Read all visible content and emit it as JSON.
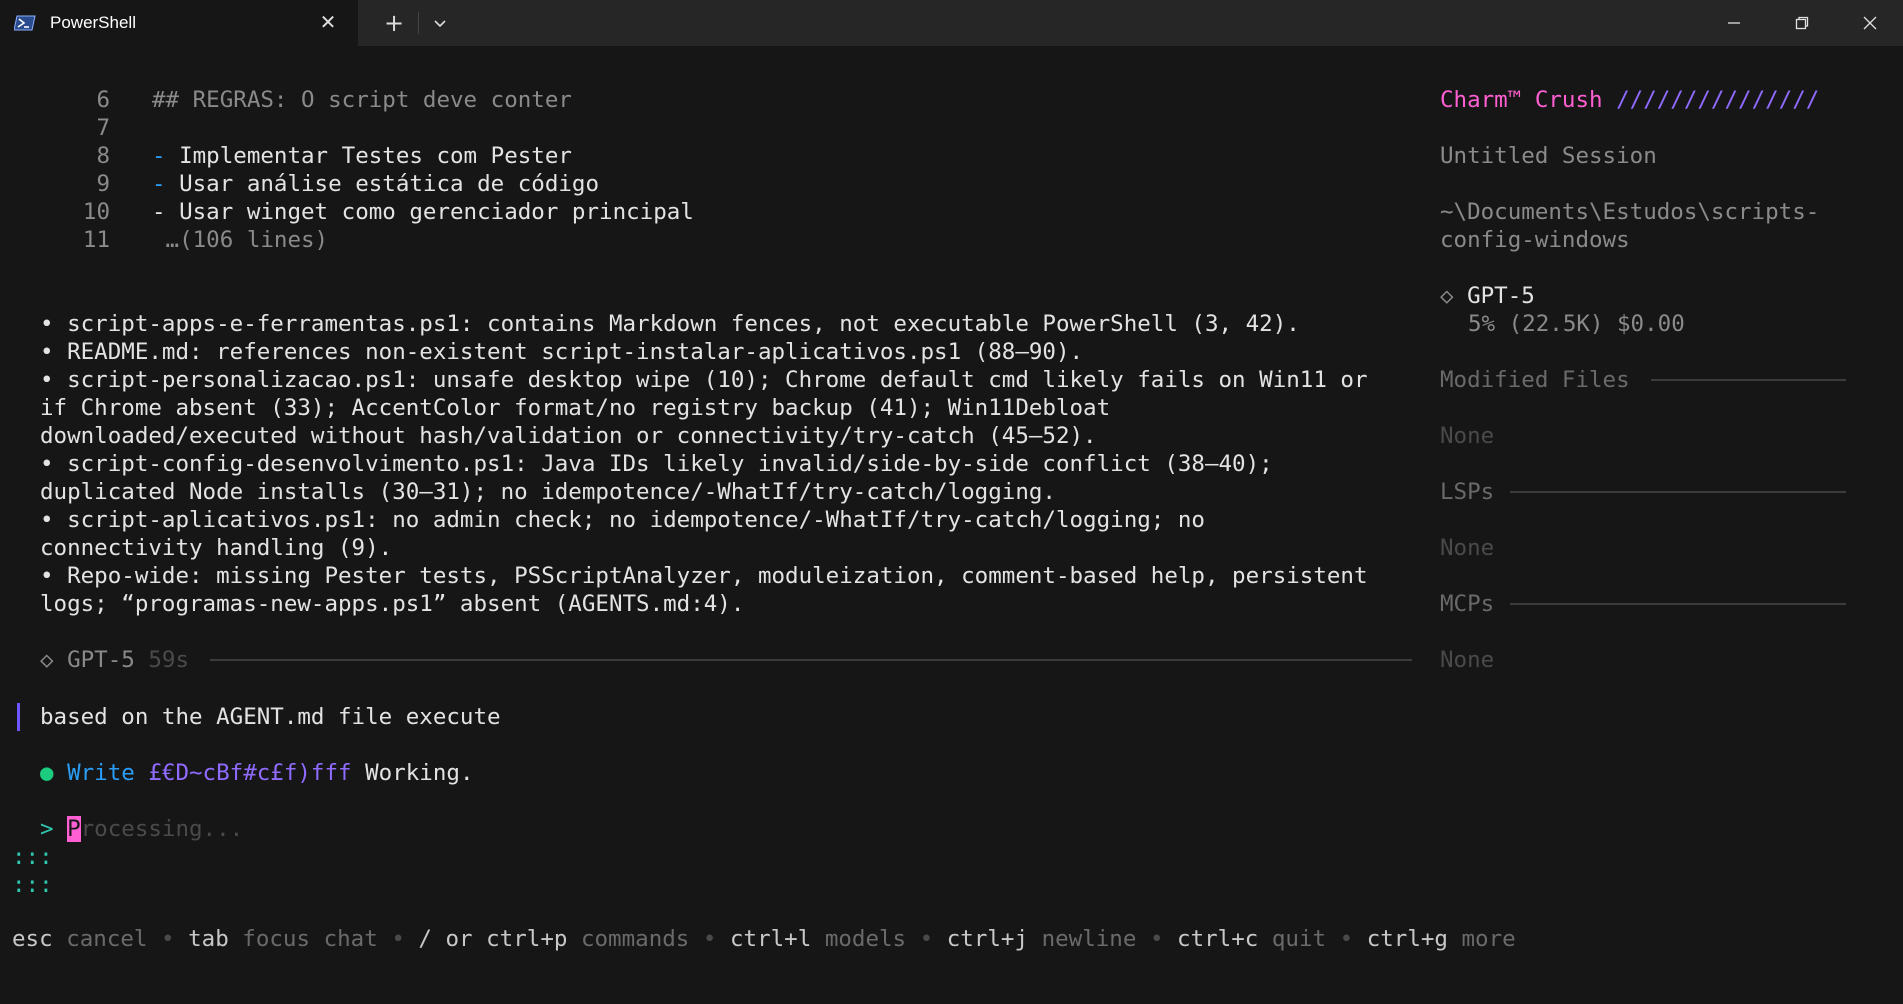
{
  "window": {
    "tab_title": "PowerShell",
    "close_glyph": "✕",
    "new_tab_glyph": "+",
    "icons": [
      "powershell-icon",
      "close-icon",
      "plus-icon",
      "chevron-down-icon",
      "minimize-icon",
      "maximize-icon",
      "window-close-icon"
    ]
  },
  "code_preview": {
    "lines": [
      {
        "num": "6",
        "text": "## REGRAS: O script deve conter"
      },
      {
        "num": "7",
        "text": ""
      },
      {
        "num": "8",
        "bullet": "-",
        "text": " Implementar Testes com Pester"
      },
      {
        "num": "9",
        "bullet": "-",
        "text": " Usar análise estática de código"
      },
      {
        "num": "10",
        "text": "- Usar winget como gerenciador principal"
      },
      {
        "num": "11",
        "text": " …(106 lines)"
      }
    ]
  },
  "findings": [
    "• script-apps-e-ferramentas.ps1: contains Markdown fences, not executable PowerShell (3, 42).",
    "• README.md: references non-existent script-instalar-aplicativos.ps1 (88–90).",
    "• script-personalizacao.ps1: unsafe desktop wipe (10); Chrome default cmd likely fails on Win11 or",
    "if Chrome absent (33); AccentColor format/no registry backup (41); Win11Debloat",
    "downloaded/executed without hash/validation or connectivity/try-catch (45–52).",
    "• script-config-desenvolvimento.ps1: Java IDs likely invalid/side-by-side conflict (38–40);",
    "duplicated Node installs (30–31); no idempotence/-WhatIf/try-catch/logging.",
    "• script-aplicativos.ps1: no admin check; no idempotence/-WhatIf/try-catch/logging; no",
    "connectivity handling (9).",
    "• Repo-wide: missing Pester tests, PSScriptAnalyzer, moduleization, comment-based help, persistent",
    "logs; “programas-new-apps.ps1” absent (AGENTS.md:4)."
  ],
  "model_footer": {
    "diamond": "◇",
    "model": "GPT-5",
    "duration": "59s"
  },
  "user_prompt": "based on the AGENT.md file execute",
  "tool_call": {
    "dot": "●",
    "name": "Write",
    "arg": "£€D~cBf#c£f)fff",
    "status": "Working."
  },
  "input": {
    "prompt": ">",
    "cursor_char": "P",
    "placeholder_rest": "rocessing..."
  },
  "spinner": [
    ":::",
    ":::"
  ],
  "sidebar": {
    "brand": "Charm™ Crush",
    "brand_stripes": "///////////////",
    "session": "Untitled Session",
    "path_line1": "~\\Documents\\Estudos\\scripts-",
    "path_line2": "config-windows",
    "model_diamond": "◇",
    "model": "GPT-5",
    "usage": "5% (22.5K)",
    "cost": "$0.00",
    "sections": [
      {
        "title": "Modified Files",
        "value": "None"
      },
      {
        "title": "LSPs",
        "value": "None"
      },
      {
        "title": "MCPs",
        "value": "None"
      }
    ]
  },
  "help_bar": [
    {
      "key": "esc",
      "desc": "cancel"
    },
    {
      "key": "tab",
      "desc": "focus chat"
    },
    {
      "key": "/ or ctrl+p",
      "desc": "commands"
    },
    {
      "key": "ctrl+l",
      "desc": "models"
    },
    {
      "key": "ctrl+j",
      "desc": "newline"
    },
    {
      "key": "ctrl+c",
      "desc": "quit"
    },
    {
      "key": "ctrl+g",
      "desc": "more"
    }
  ],
  "help_sep": "•",
  "colors": {
    "accent_pink": "#ff5fd2",
    "accent_purple": "#8f6bff",
    "accent_blue": "#2b9df4",
    "accent_green": "#1bcb7e"
  }
}
